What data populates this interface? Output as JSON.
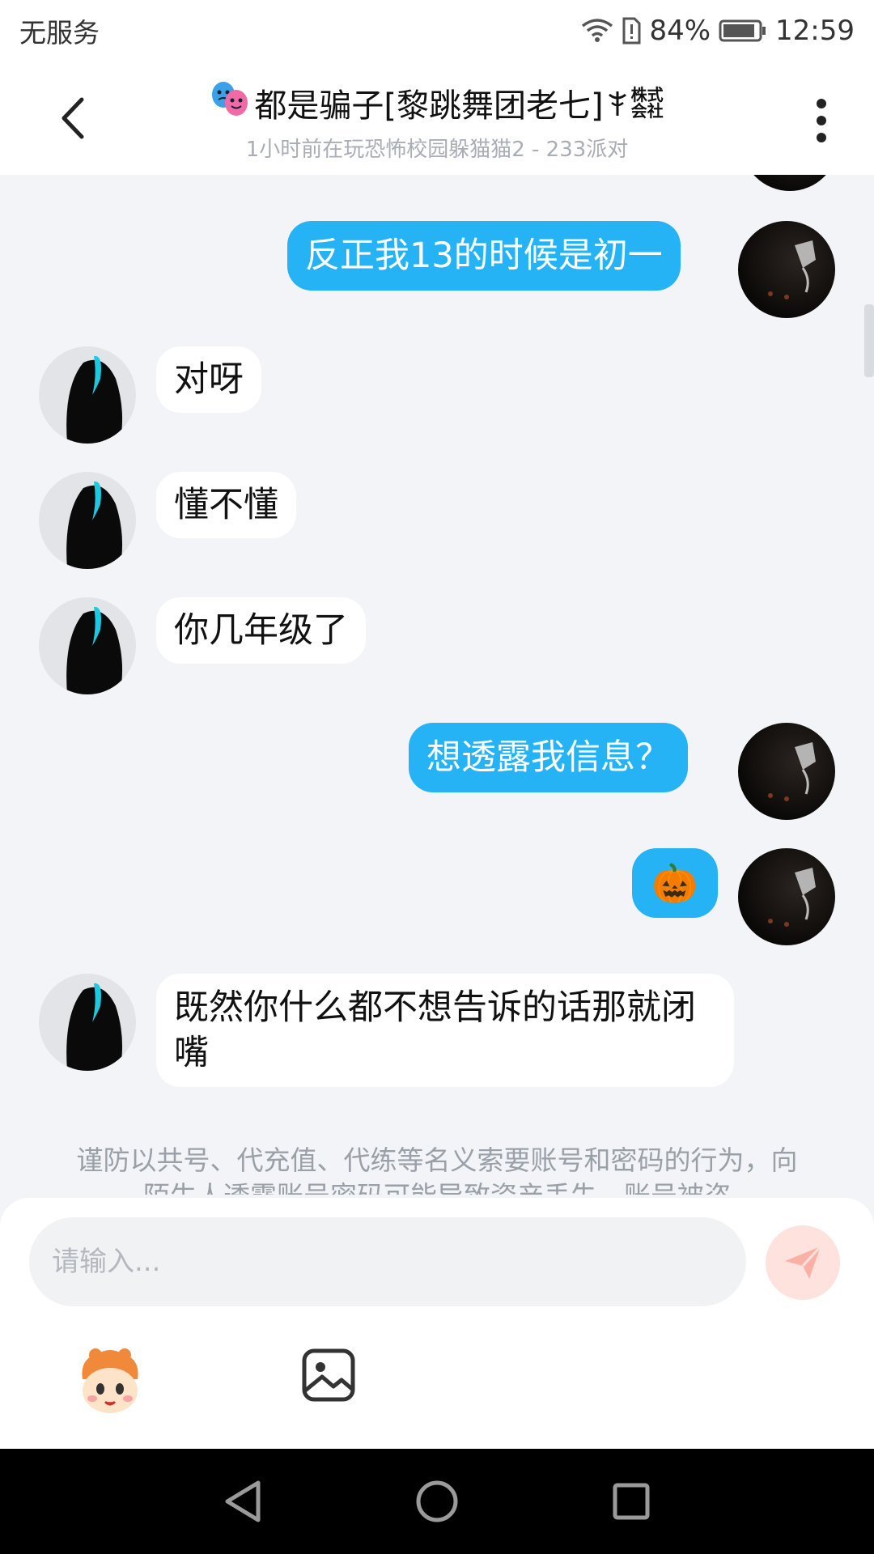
{
  "status_bar": {
    "carrier": "无服务",
    "battery": "84%",
    "time": "12:59"
  },
  "header": {
    "title": "都是骗子[黎跳舞团老七]",
    "title_suffix_top": "株式",
    "title_suffix_bottom": "会社",
    "subtitle": "1小时前在玩恐怖校园躲猫猫2 - 233派对"
  },
  "messages": [
    {
      "from": "me",
      "text": "反正我13的时候是初一"
    },
    {
      "from": "other",
      "text": "对呀"
    },
    {
      "from": "other",
      "text": "懂不懂"
    },
    {
      "from": "other",
      "text": "你几年级了"
    },
    {
      "from": "me",
      "text": "想透露我信息？"
    },
    {
      "from": "me",
      "text": "🎃"
    },
    {
      "from": "other",
      "text": "既然你什么都不想告诉的话那就闭嘴"
    }
  ],
  "notice": "谨防以共号、代充值、代练等名义索要账号和密码的行为，向陌生人透露账号密码可能导致资产丢失，账号被盗",
  "input": {
    "placeholder": "请输入..."
  },
  "colors": {
    "my_bubble": "#26b3f5",
    "other_bubble": "#ffffff",
    "chat_bg": "#f2f4f7",
    "send_button": "#fde2de"
  },
  "icons": [
    "back-icon",
    "more-icon",
    "theater-masks-icon",
    "send-icon",
    "emoji-face-icon",
    "image-icon",
    "nav-back-icon",
    "nav-home-icon",
    "nav-recents-icon"
  ]
}
